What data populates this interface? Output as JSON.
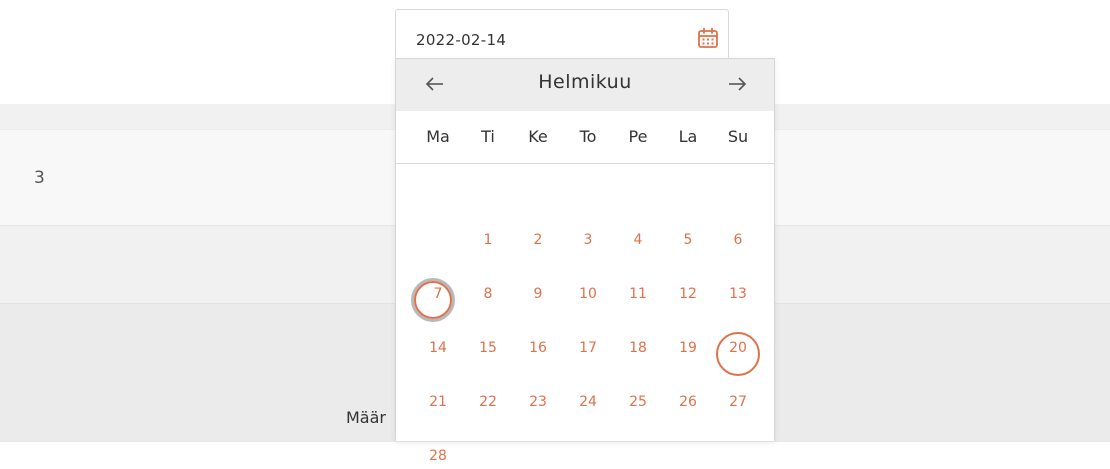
{
  "page": {
    "row_value": "3",
    "field_label": "Määr"
  },
  "date_input": {
    "value": "2022-02-14",
    "icon": "calendar-icon"
  },
  "datepicker": {
    "month_title": "Helmikuu",
    "prev_icon": "arrow-left-icon",
    "next_icon": "arrow-right-icon",
    "weekdays": [
      "Ma",
      "Ti",
      "Ke",
      "To",
      "Pe",
      "La",
      "Su"
    ],
    "days": [
      "1",
      "2",
      "3",
      "4",
      "5",
      "6",
      "7",
      "8",
      "9",
      "10",
      "11",
      "12",
      "13",
      "14",
      "15",
      "16",
      "17",
      "18",
      "19",
      "20",
      "21",
      "22",
      "23",
      "24",
      "25",
      "26",
      "27",
      "28"
    ],
    "first_weekday_offset": 1,
    "selected_day": "14",
    "highlighted_day": "27"
  },
  "colors": {
    "accent": "#e0714a",
    "header_bg": "#ededed",
    "selected_outer_ring": "#b9b9b9"
  }
}
